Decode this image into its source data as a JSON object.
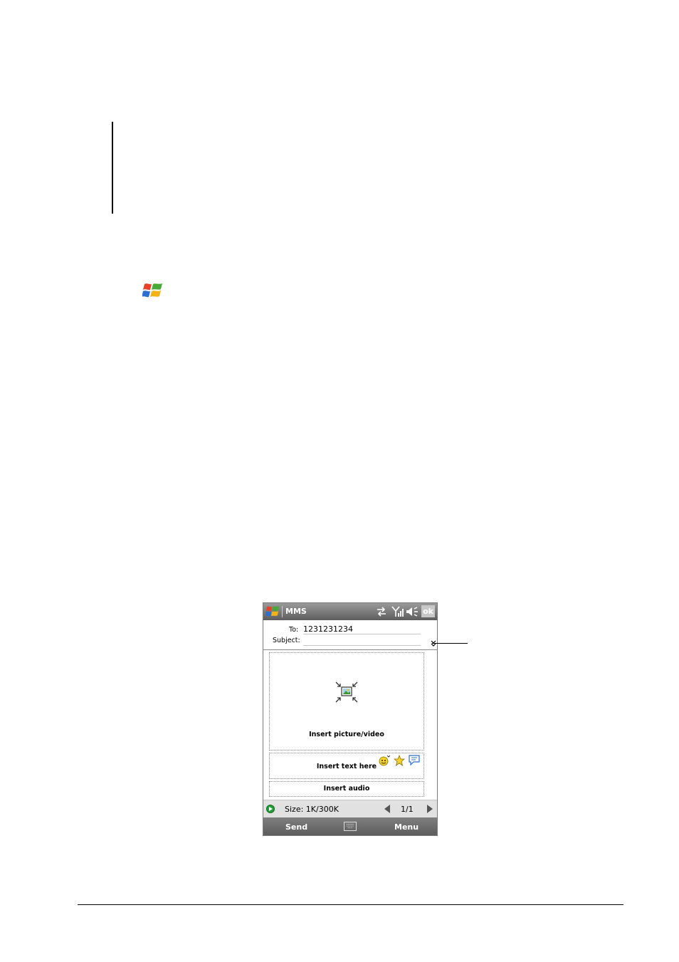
{
  "app": {
    "title": "MMS",
    "ok_label": "ok"
  },
  "header": {
    "to_label": "To:",
    "to_value": "1231231234",
    "subject_label": "Subject:",
    "subject_value": ""
  },
  "slots": {
    "picture_label": "Insert picture/video",
    "text_label": "Insert text here",
    "audio_label": "Insert audio"
  },
  "status": {
    "size_text": "Size: 1K/300K",
    "page_text": "1/1"
  },
  "softkeys": {
    "left_label": "Send",
    "right_label": "Menu"
  },
  "icons": [
    "windows-start-icon",
    "sync-icon",
    "signal-icon",
    "speaker-icon",
    "picture-icon",
    "emoticon-icon",
    "star-icon",
    "speech-bubble-icon",
    "play-icon",
    "keyboard-icon"
  ],
  "colors": {
    "titlebar": "#5d5d5d",
    "statusbar": "#e1e1e1",
    "play_green": "#21a035"
  }
}
